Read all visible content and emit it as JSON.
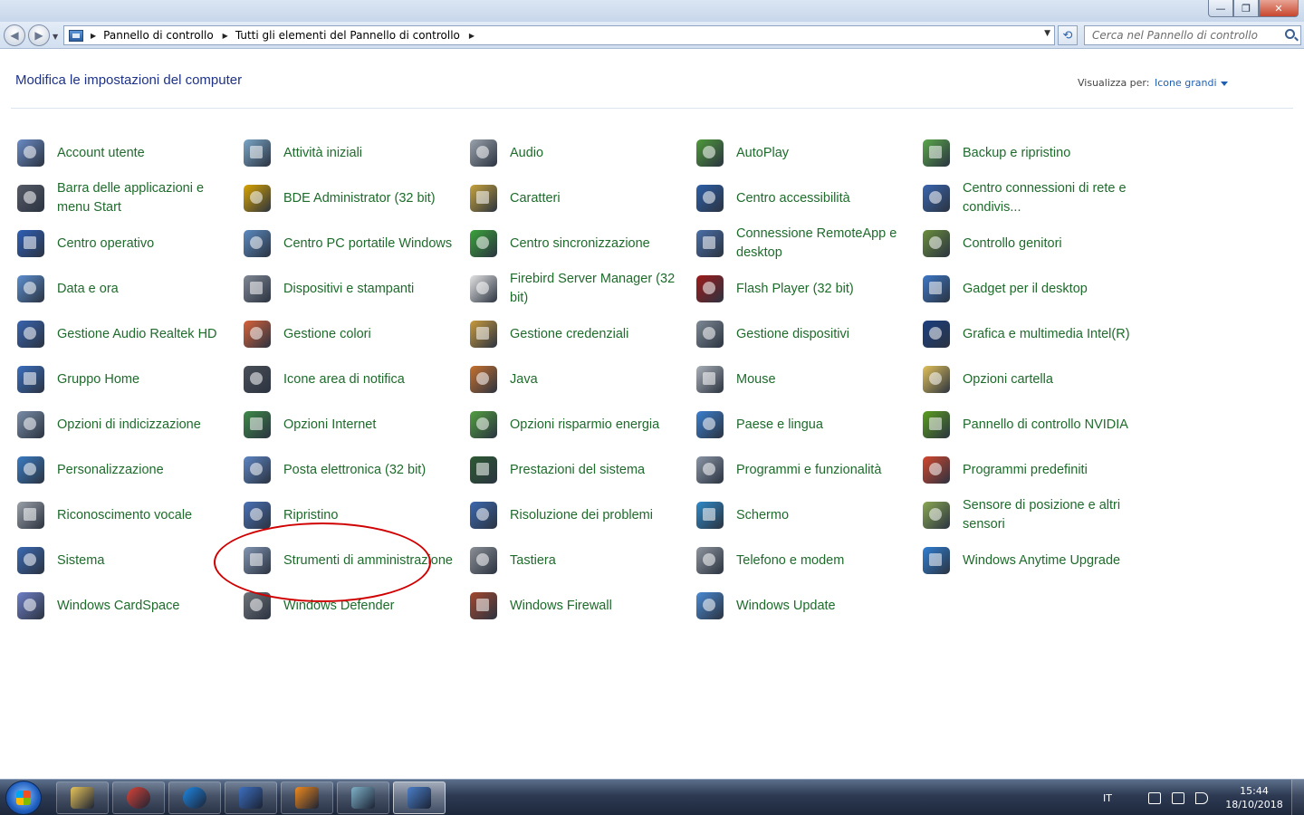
{
  "window": {
    "minimize_glyph": "—",
    "maximize_glyph": "❐",
    "close_glyph": "✕"
  },
  "nav": {
    "back_glyph": "◀",
    "forward_glyph": "▶",
    "breadcrumbs": [
      "Pannello di controllo",
      "Tutti gli elementi del Pannello di controllo"
    ],
    "refresh_glyph": "⟲",
    "search_placeholder": "Cerca nel Pannello di controllo"
  },
  "header": {
    "title": "Modifica le impostazioni del computer",
    "view_label": "Visualizza per:",
    "view_value": "Icone grandi"
  },
  "items": [
    {
      "label": "Account utente",
      "color": "#6b8cc7"
    },
    {
      "label": "Attività iniziali",
      "color": "#7aa6c8"
    },
    {
      "label": "Audio",
      "color": "#9aa3ad"
    },
    {
      "label": "AutoPlay",
      "color": "#4f9a3a"
    },
    {
      "label": "Backup e ripristino",
      "color": "#5aa84a"
    },
    {
      "label": "Barra delle applicazioni e menu Start",
      "color": "#555a66"
    },
    {
      "label": "BDE Administrator (32 bit)",
      "color": "#d9a400"
    },
    {
      "label": "Caratteri",
      "color": "#c7a33c"
    },
    {
      "label": "Centro accessibilità",
      "color": "#2d5fa8"
    },
    {
      "label": "Centro connessioni di rete e condivis...",
      "color": "#3a66b0"
    },
    {
      "label": "Centro operativo",
      "color": "#2f5fb8"
    },
    {
      "label": "Centro PC portatile Windows",
      "color": "#5b8bc2"
    },
    {
      "label": "Centro sincronizzazione",
      "color": "#3aa33a"
    },
    {
      "label": "Connessione RemoteApp e desktop",
      "color": "#4a6fa8"
    },
    {
      "label": "Controllo genitori",
      "color": "#6a8e3c"
    },
    {
      "label": "Data e ora",
      "color": "#5c8fd0"
    },
    {
      "label": "Dispositivi e stampanti",
      "color": "#7f8894"
    },
    {
      "label": "Firebird Server Manager (32 bit)",
      "color": "#e4e4e4"
    },
    {
      "label": "Flash Player (32 bit)",
      "color": "#9e1a1a"
    },
    {
      "label": "Gadget per il desktop",
      "color": "#3d78c8"
    },
    {
      "label": "Gestione Audio Realtek HD",
      "color": "#3864b0"
    },
    {
      "label": "Gestione colori",
      "color": "#d8623a"
    },
    {
      "label": "Gestione credenziali",
      "color": "#c99b3e"
    },
    {
      "label": "Gestione dispositivi",
      "color": "#7e8a96"
    },
    {
      "label": "Grafica e multimedia Intel(R)",
      "color": "#1b3f80"
    },
    {
      "label": "Gruppo Home",
      "color": "#3a6fc0"
    },
    {
      "label": "Icone area di notifica",
      "color": "#4a4f58"
    },
    {
      "label": "Java",
      "color": "#c7712e"
    },
    {
      "label": "Mouse",
      "color": "#a9b0b8"
    },
    {
      "label": "Opzioni cartella",
      "color": "#e2c25a"
    },
    {
      "label": "Opzioni di indicizzazione",
      "color": "#7a8da8"
    },
    {
      "label": "Opzioni Internet",
      "color": "#3d8a48"
    },
    {
      "label": "Opzioni risparmio energia",
      "color": "#52a040"
    },
    {
      "label": "Paese e lingua",
      "color": "#3b7fd0"
    },
    {
      "label": "Pannello di controllo NVIDIA",
      "color": "#5a9e1e"
    },
    {
      "label": "Personalizzazione",
      "color": "#3a7cc4"
    },
    {
      "label": "Posta elettronica (32 bit)",
      "color": "#5d86c5"
    },
    {
      "label": "Prestazioni del sistema",
      "color": "#2d5a32"
    },
    {
      "label": "Programmi e funzionalità",
      "color": "#8a95a5"
    },
    {
      "label": "Programmi predefiniti",
      "color": "#d4472e"
    },
    {
      "label": "Riconoscimento vocale",
      "color": "#9aa0a8"
    },
    {
      "label": "Ripristino",
      "color": "#4a72b8"
    },
    {
      "label": "Risoluzione dei problemi",
      "color": "#3c68b0"
    },
    {
      "label": "Schermo",
      "color": "#2f8ac8"
    },
    {
      "label": "Sensore di posizione e altri sensori",
      "color": "#8aa852"
    },
    {
      "label": "Sistema",
      "color": "#3a6ab4"
    },
    {
      "label": "Strumenti di amministrazione",
      "color": "#8296b4"
    },
    {
      "label": "Tastiera",
      "color": "#8c9096"
    },
    {
      "label": "Telefono e modem",
      "color": "#8e959e"
    },
    {
      "label": "Windows Anytime Upgrade",
      "color": "#2f7fd4"
    },
    {
      "label": "Windows CardSpace",
      "color": "#6e7fc8"
    },
    {
      "label": "Windows Defender",
      "color": "#6f747a"
    },
    {
      "label": "Windows Firewall",
      "color": "#a3482e"
    },
    {
      "label": "Windows Update",
      "color": "#4a8ad4"
    }
  ],
  "taskbar": {
    "apps": [
      {
        "name": "explorer",
        "color": "#e8c45a"
      },
      {
        "name": "chrome",
        "color": "#db4437"
      },
      {
        "name": "internet-explorer",
        "color": "#1e88e5"
      },
      {
        "name": "app-blue",
        "color": "#3d6fc0"
      },
      {
        "name": "media-player",
        "color": "#f08a1e"
      },
      {
        "name": "app-teal",
        "color": "#7fb2c8"
      },
      {
        "name": "control-panel",
        "color": "#4a7fc8"
      }
    ],
    "language": "IT",
    "time": "15:44",
    "date": "18/10/2018"
  }
}
